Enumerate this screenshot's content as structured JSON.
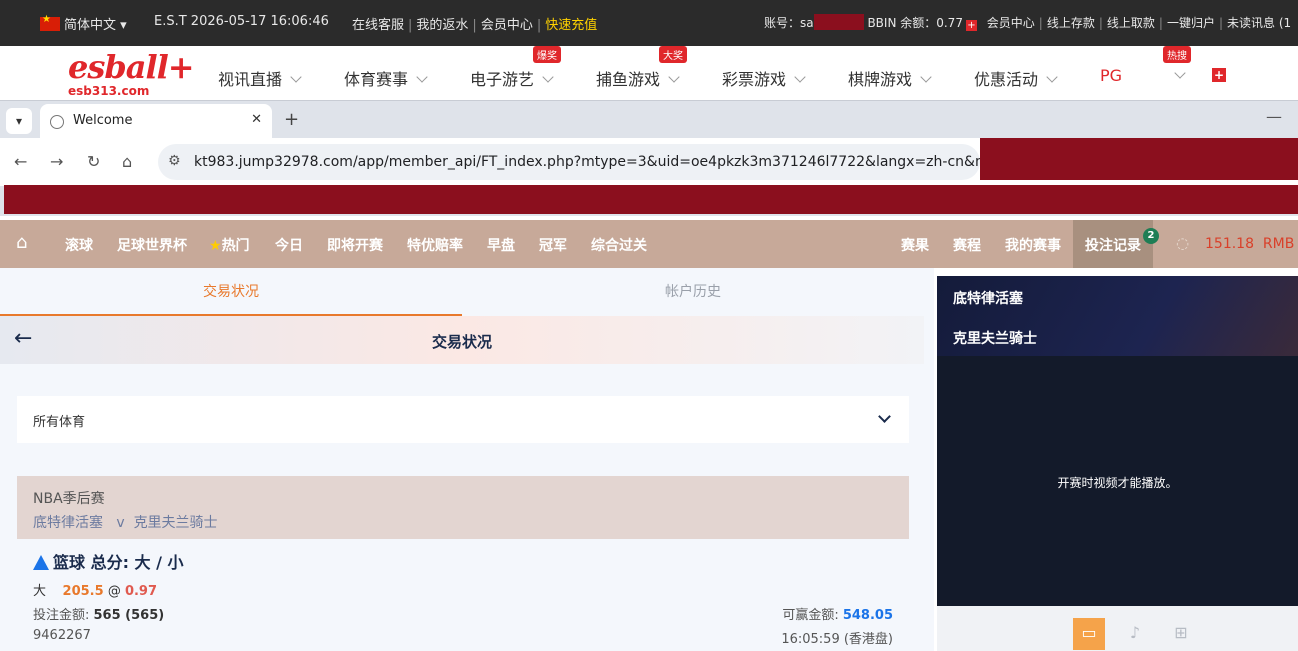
{
  "topbar": {
    "language": "简体中文",
    "datetime": "E.S.T 2026-05-17 16:06:46",
    "links": [
      "在线客服",
      "我的返水",
      "会员中心"
    ],
    "quick_topup": "快速充值",
    "account_label": "账号：sa",
    "balance_label": "BBIN 余额：0.77",
    "right_links": [
      "会员中心",
      "线上存款",
      "线上取款",
      "一键归户",
      "未读讯息 (1"
    ]
  },
  "site_nav": {
    "logo": "esball+",
    "logo_sub": "esb313.com",
    "items": [
      "视讯直播",
      "体育赛事",
      "电子游艺",
      "捕鱼游戏",
      "彩票游戏",
      "棋牌游戏",
      "优惠活动",
      "PG"
    ],
    "badges": {
      "slots": "爆奖",
      "fishing": "大奖",
      "hot": "热搜"
    }
  },
  "browser": {
    "tab_title": "Welcome",
    "url": "kt983.jump32978.com/app/member_api/FT_index.php?mtype=3&uid=oe4pkzk3m371246l7722&langx=zh-cn&ne..."
  },
  "sports_nav": {
    "items": [
      "滚球",
      "足球世界杯",
      "热门",
      "今日",
      "即将开赛",
      "特优赔率",
      "早盘",
      "冠军",
      "综合过关"
    ],
    "right_items": [
      "赛果",
      "赛程",
      "我的赛事",
      "投注记录"
    ],
    "bet_count": "2",
    "balance": "151.18",
    "currency": "RMB"
  },
  "tabs": {
    "trade_status": "交易状况",
    "account_history": "帐户历史"
  },
  "header": {
    "title": "交易状况"
  },
  "filter": {
    "selected": "所有体育"
  },
  "match": {
    "league": "NBA季后赛",
    "home": "底特律活塞",
    "vs": "v",
    "away": "克里夫兰骑士"
  },
  "bet": {
    "title": "篮球 总分: 大 / 小",
    "selection": "大",
    "line": "205.5",
    "at": "@",
    "odds": "0.97",
    "stake_label": "投注金额: ",
    "stake": "565 (565)",
    "win_label": "可赢金额: ",
    "win": "548.05",
    "ticket_id": "9462267",
    "time": "16:05:59 (香港盘)"
  },
  "video": {
    "home": "底特律活塞",
    "away": "克里夫兰骑士",
    "message": "开赛时视频才能播放。"
  }
}
